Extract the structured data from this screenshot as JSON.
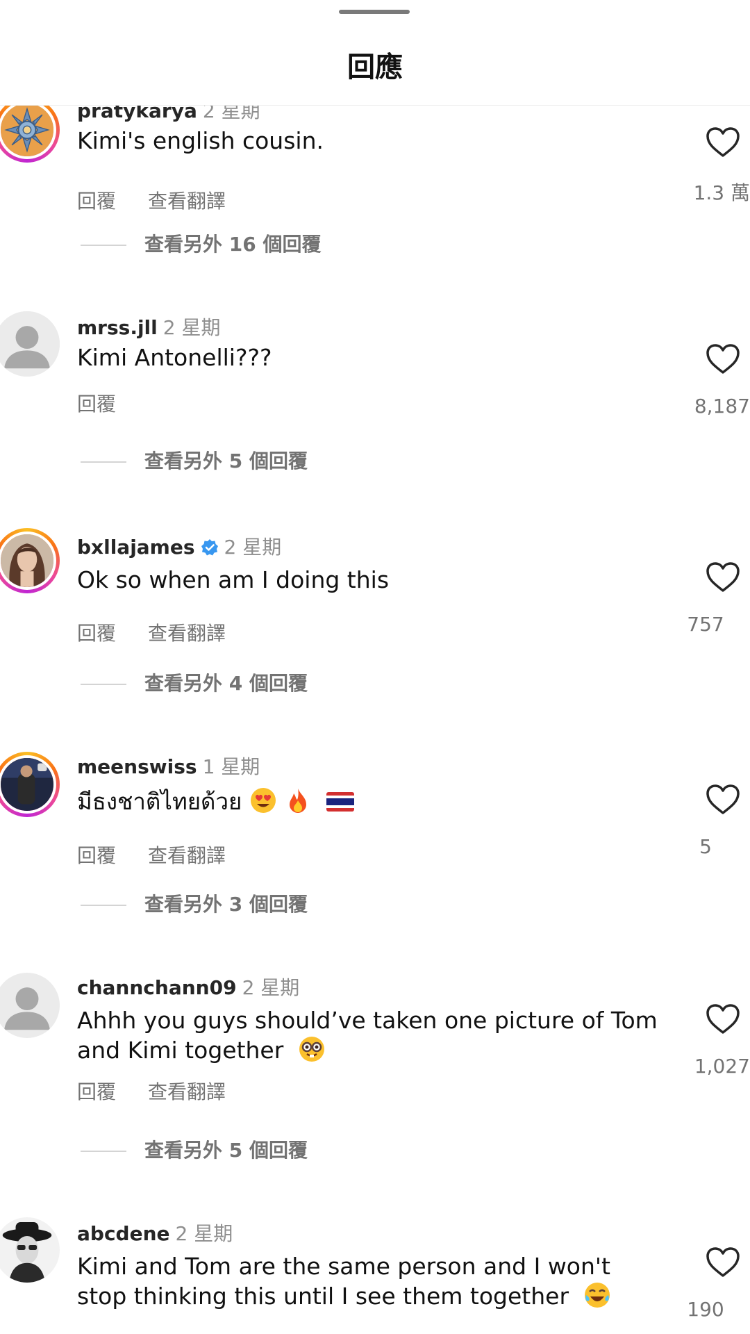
{
  "header": {
    "title": "回應"
  },
  "comments": [
    {
      "username": "pratykarya",
      "time": "2 星期",
      "text": "Kimi's english cousin.",
      "actions": {
        "reply": "回覆",
        "translate": "查看翻譯"
      },
      "more_replies": "查看另外 16 個回覆",
      "likes": "1.3 萬",
      "avatar": "sun-emblem-avatar"
    },
    {
      "username": "mrss.jll",
      "time": "2 星期",
      "text": "Kimi Antonelli???",
      "actions": {
        "reply": "回覆"
      },
      "more_replies": "查看另外 5 個回覆",
      "likes": "8,187",
      "avatar": "default-avatar"
    },
    {
      "username": "bxllajames",
      "verified": true,
      "time": "2 星期",
      "text": "Ok so when am I doing this",
      "actions": {
        "reply": "回覆",
        "translate": "查看翻譯"
      },
      "more_replies": "查看另外 4 個回覆",
      "likes": "757",
      "avatar": "photo-avatar"
    },
    {
      "username": "meenswiss",
      "time": "1 星期",
      "text": "มีธงชาติไทยด้วย",
      "emojis": [
        "heart-eyes-emoji",
        "fire-emoji",
        "thai-flag-emoji"
      ],
      "actions": {
        "reply": "回覆",
        "translate": "查看翻譯"
      },
      "more_replies": "查看另外 3 個回覆",
      "likes": "5",
      "avatar": "photo-avatar"
    },
    {
      "username": "channchann09",
      "time": "2 星期",
      "text_line1": "Ahhh you guys should’ve taken one picture of Tom",
      "text_line2": "and Kimi together",
      "emojis": [
        "nerd-face-emoji"
      ],
      "actions": {
        "reply": "回覆",
        "translate": "查看翻譯"
      },
      "more_replies": "查看另外 5 個回覆",
      "likes": "1,027",
      "avatar": "default-avatar"
    },
    {
      "username": "abcdene",
      "time": "2 星期",
      "text_line1": "Kimi and Tom are the same person and I won't",
      "text_line2": "stop thinking this until I see them together",
      "emojis": [
        "tears-of-joy-emoji"
      ],
      "likes": "190",
      "avatar": "photo-avatar"
    }
  ],
  "colors": {
    "text": "#111111",
    "secondary": "#737373",
    "verified": "#3897f0",
    "story_ring": [
      "#fbbf24",
      "#f97316",
      "#ec4899",
      "#c026d3"
    ]
  }
}
